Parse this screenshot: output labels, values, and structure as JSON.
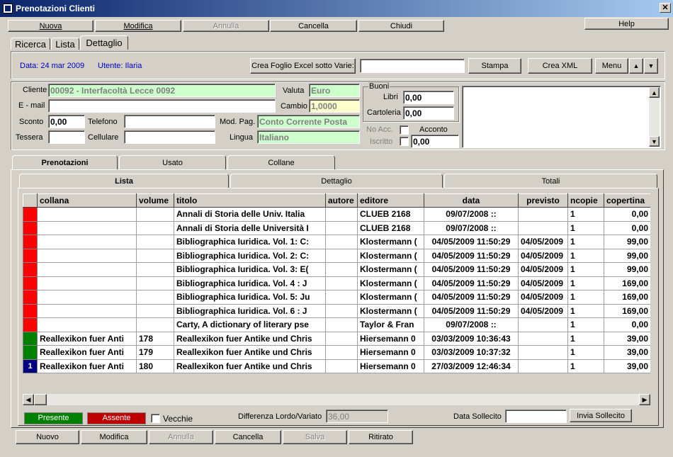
{
  "window": {
    "title": "Prenotazioni Clienti",
    "help": "Help",
    "close": "✕"
  },
  "toolbar": {
    "nuova": "Nuova",
    "modifica": "Modifica",
    "annulla": "Annulla",
    "cancella": "Cancella",
    "chiudi": "Chiudi"
  },
  "view_tabs": [
    "Ricerca",
    "Lista",
    "Dettaglio"
  ],
  "info": {
    "data": "Data: 24 mar 2009",
    "utente": "Utente: Ilaria",
    "excel": "Crea Foglio Excel sotto Varie:",
    "excel_value": "",
    "stampa": "Stampa",
    "xml": "Crea XML",
    "menu": "Menu"
  },
  "form": {
    "cliente_label": "Cliente",
    "cliente": "00092 - Interfacoltà Lecce 0092",
    "valuta_label": "Valuta",
    "valuta": "Euro",
    "email_label": "E - mail",
    "email": "",
    "cambio_label": "Cambio",
    "cambio": "1,0000",
    "sconto_label": "Sconto",
    "sconto": "0,00",
    "telefono_label": "Telefono",
    "telefono": "",
    "modpag_label": "Mod. Pag.",
    "modpag": "Conto Corrente Posta",
    "tessera_label": "Tessera",
    "tessera": "",
    "cellulare_label": "Cellulare",
    "cellulare": "",
    "lingua_label": "Lingua",
    "lingua": "Italiano",
    "buoni_label": "Buoni",
    "libri_label": "Libri",
    "libri": "0,00",
    "cartoleria_label": "Cartoleria",
    "cartoleria": "0,00",
    "noacc_label": "No Acc.",
    "acconto_label": "Acconto",
    "iscritto_label": "Iscritto",
    "acconto": "0,00"
  },
  "main_tabs": [
    "Prenotazioni",
    "Usato",
    "Collane"
  ],
  "sub_tabs": [
    "Lista",
    "Dettaglio",
    "Totali"
  ],
  "table": {
    "columns": [
      "collana",
      "volume",
      "titolo",
      "autore",
      "editore",
      "data",
      "previsto",
      "ncopie",
      "copertina"
    ],
    "rows": [
      {
        "status": "red",
        "marker": "",
        "collana": "",
        "volume": "",
        "titolo": "Annali di Storia delle Univ. Italia",
        "autore": "",
        "editore": "CLUEB 2168",
        "data": "09/07/2008 ::",
        "previsto": "",
        "ncopie": "1",
        "copertina": "0,00"
      },
      {
        "status": "red",
        "marker": "",
        "collana": "",
        "volume": "",
        "titolo": "Annali di Storia delle Università I",
        "autore": "",
        "editore": "CLUEB 2168",
        "data": "09/07/2008 ::",
        "previsto": "",
        "ncopie": "1",
        "copertina": "0,00"
      },
      {
        "status": "red",
        "marker": "",
        "collana": "",
        "volume": "",
        "titolo": "Bibliographica Iuridica. Vol. 1: C:",
        "autore": "",
        "editore": "Klostermann (",
        "data": "04/05/2009 11:50:29",
        "previsto": "04/05/2009",
        "ncopie": "1",
        "copertina": "99,00"
      },
      {
        "status": "red",
        "marker": "",
        "collana": "",
        "volume": "",
        "titolo": "Bibliographica Iuridica. Vol. 2: C:",
        "autore": "",
        "editore": "Klostermann (",
        "data": "04/05/2009 11:50:29",
        "previsto": "04/05/2009",
        "ncopie": "1",
        "copertina": "99,00"
      },
      {
        "status": "red",
        "marker": "",
        "collana": "",
        "volume": "",
        "titolo": "Bibliographica Iuridica. Vol. 3: E(",
        "autore": "",
        "editore": "Klostermann (",
        "data": "04/05/2009 11:50:29",
        "previsto": "04/05/2009",
        "ncopie": "1",
        "copertina": "99,00"
      },
      {
        "status": "red",
        "marker": "",
        "collana": "",
        "volume": "",
        "titolo": "Bibliographica Iuridica. Vol. 4 : J",
        "autore": "",
        "editore": "Klostermann (",
        "data": "04/05/2009 11:50:29",
        "previsto": "04/05/2009",
        "ncopie": "1",
        "copertina": "169,00"
      },
      {
        "status": "red",
        "marker": "",
        "collana": "",
        "volume": "",
        "titolo": "Bibliographica Iuridica. Vol. 5: Ju",
        "autore": "",
        "editore": "Klostermann (",
        "data": "04/05/2009 11:50:29",
        "previsto": "04/05/2009",
        "ncopie": "1",
        "copertina": "169,00"
      },
      {
        "status": "red",
        "marker": "",
        "collana": "",
        "volume": "",
        "titolo": "Bibliographica Iuridica. Vol. 6 : J",
        "autore": "",
        "editore": "Klostermann (",
        "data": "04/05/2009 11:50:29",
        "previsto": "04/05/2009",
        "ncopie": "1",
        "copertina": "169,00"
      },
      {
        "status": "red",
        "marker": "",
        "collana": "",
        "volume": "",
        "titolo": "Carty, A dictionary of literary pse",
        "autore": "",
        "editore": "Taylor & Fran",
        "data": "09/07/2008 ::",
        "previsto": "",
        "ncopie": "1",
        "copertina": "0,00"
      },
      {
        "status": "green",
        "marker": "",
        "collana": "Reallexikon fuer Anti",
        "volume": "178",
        "titolo": "Reallexikon fuer Antike und Chris",
        "autore": "",
        "editore": "Hiersemann 0",
        "data": "03/03/2009 10:36:43",
        "previsto": "",
        "ncopie": "1",
        "copertina": "39,00"
      },
      {
        "status": "green",
        "marker": "",
        "collana": "Reallexikon fuer Anti",
        "volume": "179",
        "titolo": "Reallexikon fuer Antike und Chris",
        "autore": "",
        "editore": "Hiersemann 0",
        "data": "03/03/2009 10:37:32",
        "previsto": "",
        "ncopie": "1",
        "copertina": "39,00"
      },
      {
        "status": "navy",
        "marker": "1",
        "collana": "Reallexikon fuer Anti",
        "volume": "180",
        "titolo": "Reallexikon fuer Antike und Chris",
        "autore": "",
        "editore": "Hiersemann 0",
        "data": "27/03/2009 12:46:34",
        "previsto": "",
        "ncopie": "1",
        "copertina": "39,00"
      }
    ]
  },
  "legend": {
    "presente": "Presente",
    "assente": "Assente",
    "vecchie": "Vecchie",
    "differenza_label": "Differenza Lordo/Variato",
    "differenza": "36,00",
    "sollecito_label": "Data Sollecito",
    "sollecito": "",
    "invia": "Invia Sollecito"
  },
  "bottom": {
    "nuovo": "Nuovo",
    "modifica": "Modifica",
    "annulla": "Annulla",
    "cancella": "Cancella",
    "salva": "Salva",
    "ritirato": "Ritirato"
  },
  "colors": {
    "red": "#ff0000",
    "green": "#008000",
    "navy": "#000080"
  }
}
